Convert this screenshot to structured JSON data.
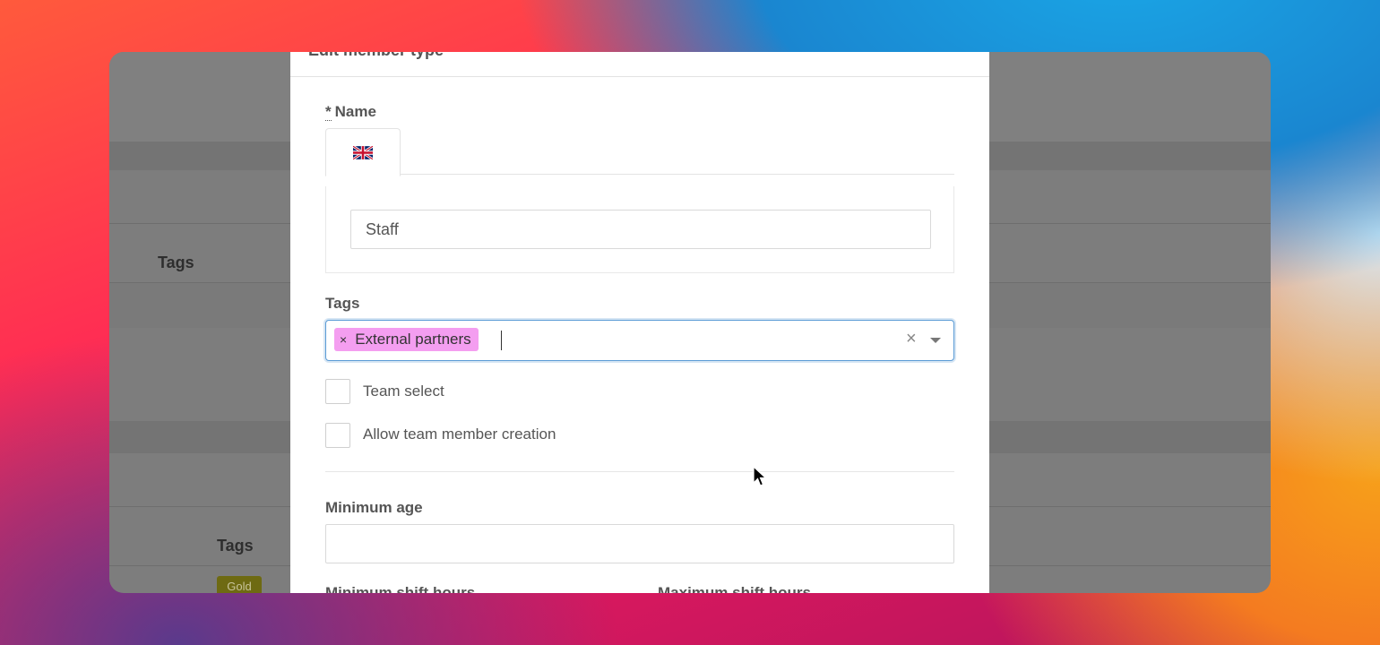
{
  "background_window": {
    "labels": [
      "Tags",
      "Tags"
    ],
    "badge": "Gold"
  },
  "modal": {
    "title": "Edit member type",
    "name_field": {
      "required_mark": "*",
      "label": "Name",
      "language_tab": "uk-flag-icon",
      "value": "Staff"
    },
    "tags_field": {
      "label": "Tags",
      "selected": [
        {
          "label": "External partners",
          "remove": "×",
          "color": "#f49ef0"
        }
      ],
      "clear": "×"
    },
    "checkboxes": [
      {
        "label": "Team select",
        "checked": false
      },
      {
        "label": "Allow team member creation",
        "checked": false
      }
    ],
    "minimum_age": {
      "label": "Minimum age",
      "value": ""
    },
    "minimum_shift_hours": {
      "label": "Minimum shift hours"
    },
    "maximum_shift_hours": {
      "label": "Maximum shift hours"
    }
  },
  "colors": {
    "focus": "#5b9bd5",
    "tag_chip": "#f49ef0",
    "gold_badge": "#6e6a12"
  }
}
